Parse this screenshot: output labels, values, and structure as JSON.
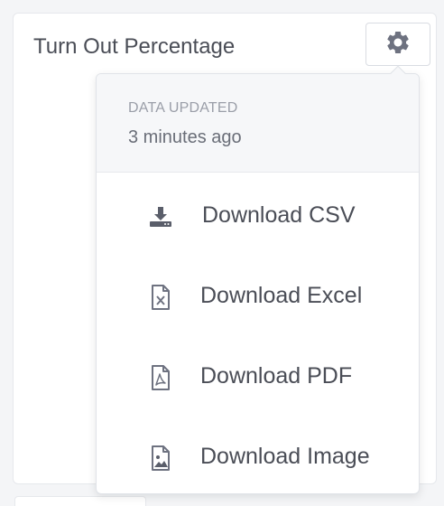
{
  "card": {
    "title": "Turn Out Percentage",
    "settings_icon": "gear-icon"
  },
  "popover": {
    "updated_label": "DATA UPDATED",
    "updated_value": "3 minutes ago",
    "items": [
      {
        "label": "Download CSV",
        "icon": "download-icon"
      },
      {
        "label": "Download Excel",
        "icon": "excel-file-icon"
      },
      {
        "label": "Download PDF",
        "icon": "pdf-file-icon"
      },
      {
        "label": "Download Image",
        "icon": "image-file-icon"
      }
    ]
  },
  "colors": {
    "text_primary": "#4a4d56",
    "text_muted": "#9a9ea8",
    "icon": "#6e7280",
    "header_bg": "#f6f7f9"
  }
}
